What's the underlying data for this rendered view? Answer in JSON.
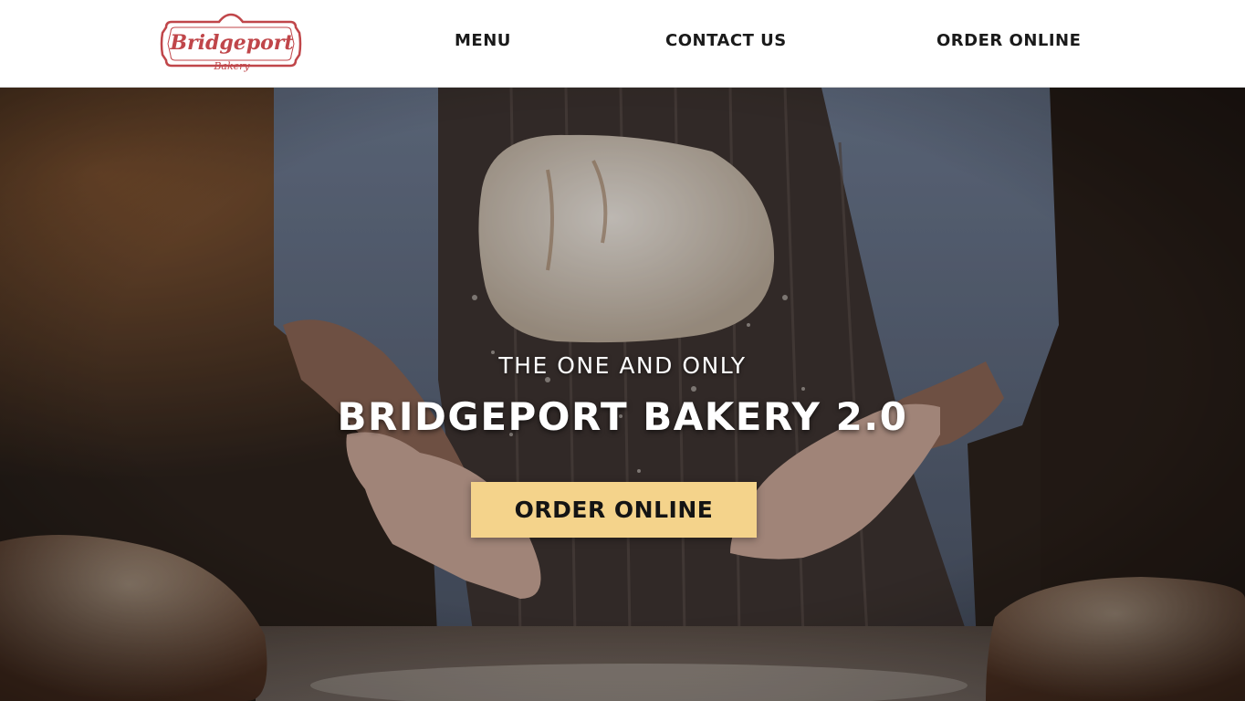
{
  "brand": {
    "logo_script": "Bridgeport",
    "logo_sub": "Bakery",
    "logo_color": "#c0464a"
  },
  "nav": {
    "items": [
      {
        "label": "MENU"
      },
      {
        "label": "CONTACT US"
      },
      {
        "label": "ORDER ONLINE"
      }
    ]
  },
  "hero": {
    "subtitle": "THE ONE AND ONLY",
    "title": "BRIDGEPORT BAKERY 2.0",
    "cta_label": "ORDER ONLINE",
    "cta_color": "#f4d38b",
    "background": "baker-tossing-flour-dough-photo"
  }
}
